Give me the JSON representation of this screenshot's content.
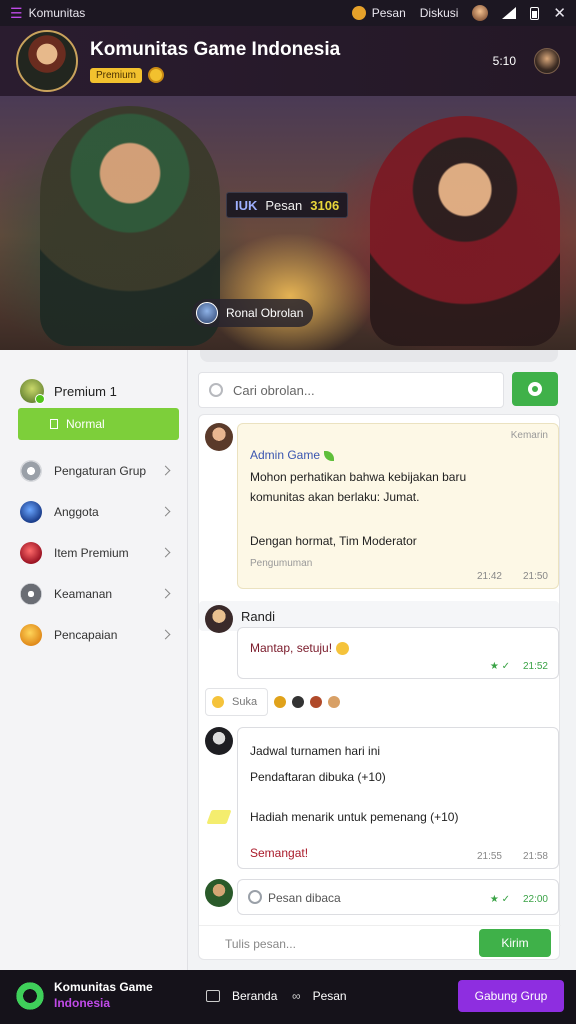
{
  "status_bar": {
    "app_label": "Komunitas",
    "center_label": "Pesan",
    "time_label": "Diskusi"
  },
  "group_header": {
    "title": "Komunitas Game Indonesia",
    "badge": "Premium",
    "right_label": "5:10"
  },
  "banner": {
    "tag_part1": "IUK",
    "tag_part2": "Pesan",
    "tag_part3": "3106",
    "chip_label": "Ronal Obrolan"
  },
  "sidebar": {
    "header_label": "Premium 1",
    "active_item": "Normal",
    "items": [
      {
        "label": "Pengaturan Grup",
        "icon": "gear-icon"
      },
      {
        "label": "Anggota",
        "icon": "globe-icon"
      },
      {
        "label": "Item Premium",
        "icon": "gem-icon"
      },
      {
        "label": "Keamanan",
        "icon": "lock-icon"
      },
      {
        "label": "Pencapaian",
        "icon": "star-icon"
      }
    ]
  },
  "search": {
    "placeholder": "Cari obrolan..."
  },
  "messages": {
    "m1": {
      "date": "Kemarin",
      "name": "Admin Game",
      "line1": "Mohon perhatikan bahwa kebijakan baru",
      "line2": "komunitas akan berlaku: Jumat.",
      "line3": "Dengan hormat, Tim Moderator",
      "sub": "Pengumuman",
      "time1": "21:42",
      "time2": "21:50"
    },
    "m2": {
      "name": "Randi",
      "text": "Mantap, setuju!",
      "time": "21:52"
    },
    "reactions": {
      "label": "Suka"
    },
    "m3": {
      "line1": "Jadwal turnamen hari ini",
      "line2": "Pendaftaran dibuka (+10)",
      "line3": "Hadiah menarik untuk pemenang (+10)",
      "line4": "Semangat!",
      "time1": "21:55",
      "time2": "21:58"
    },
    "m4": {
      "text": "Pesan dibaca",
      "time": "22:00"
    }
  },
  "composer": {
    "placeholder": "Tulis pesan...",
    "send_label": "Kirim"
  },
  "bottom_bar": {
    "brand_line1": "Komunitas Game",
    "brand_line2": "Indonesia",
    "nav1": "Beranda",
    "nav2": "Pesan",
    "cta": "Gabung Grup"
  },
  "colors": {
    "accent_green": "#3fb149",
    "sidebar_active": "#7dcf3a",
    "cta_purple": "#8e2ee0",
    "header_bg": "#2a1c2f"
  }
}
